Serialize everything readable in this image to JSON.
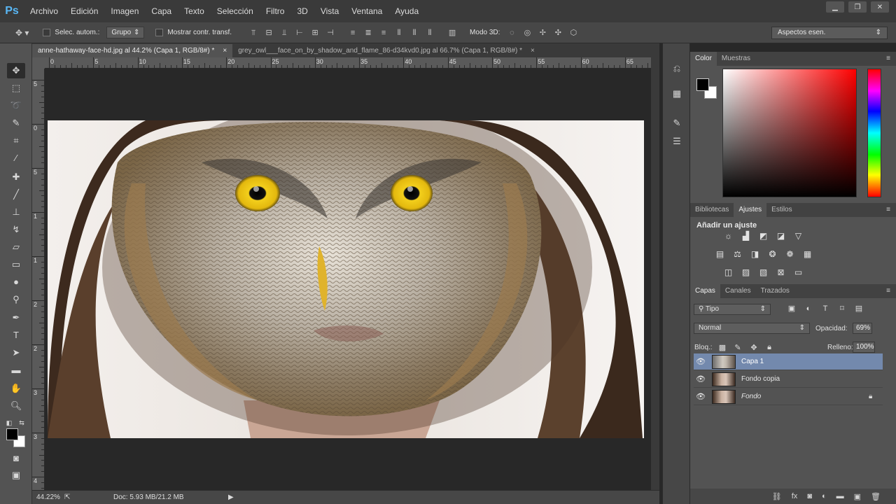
{
  "app": {
    "logo": "Ps"
  },
  "menu": [
    "Archivo",
    "Edición",
    "Imagen",
    "Capa",
    "Texto",
    "Selección",
    "Filtro",
    "3D",
    "Vista",
    "Ventana",
    "Ayuda"
  ],
  "window_controls": {
    "minimize": "▁",
    "restore": "❐",
    "close": "✕"
  },
  "options": {
    "auto_select_label": "Selec. autom.:",
    "auto_select_value": "Grupo",
    "show_transform_label": "Mostrar contr. transf.",
    "mode_3d_label": "Modo 3D:",
    "workspace": "Aspectos esen."
  },
  "documents": [
    {
      "title": "anne-hathaway-face-hd.jpg al 44.2% (Capa 1, RGB/8#) *",
      "close": "×"
    },
    {
      "title": "grey_owl___face_on_by_shadow_and_flame_86-d34kvd0.jpg al 66.7% (Capa 1, RGB/8#) *",
      "close": "×"
    }
  ],
  "ruler": {
    "h_labels": [
      "0",
      "5",
      "10",
      "15",
      "20",
      "25",
      "30",
      "35",
      "40",
      "45",
      "50",
      "55",
      "60",
      "65"
    ],
    "v_labels": [
      "5",
      "0",
      "5",
      "1",
      "1",
      "2",
      "2",
      "3",
      "3",
      "4"
    ]
  },
  "status": {
    "zoom": "44.22%",
    "doc": "Doc: 5.93 MB/21.2 MB"
  },
  "color_panel": {
    "tabs": [
      "Color",
      "Muestras"
    ]
  },
  "adjust_panel": {
    "tabs": [
      "Bibliotecas",
      "Ajustes",
      "Estilos"
    ],
    "title": "Añadir un ajuste"
  },
  "layers_panel": {
    "tabs": [
      "Capas",
      "Canales",
      "Trazados"
    ],
    "filter": "Tipo",
    "blend_mode": "Normal",
    "opacity_label": "Opacidad:",
    "opacity": "69%",
    "lock_label": "Bloq.:",
    "fill_label": "Relleno:",
    "fill": "100%",
    "layers": [
      {
        "name": "Capa 1",
        "selected": true
      },
      {
        "name": "Fondo copia",
        "selected": false
      },
      {
        "name": "Fondo",
        "selected": false,
        "locked": true
      }
    ]
  },
  "colors": {
    "accent": "#59b7f5",
    "selected_layer": "#7389ad",
    "owl_eye": "#f0c814"
  }
}
